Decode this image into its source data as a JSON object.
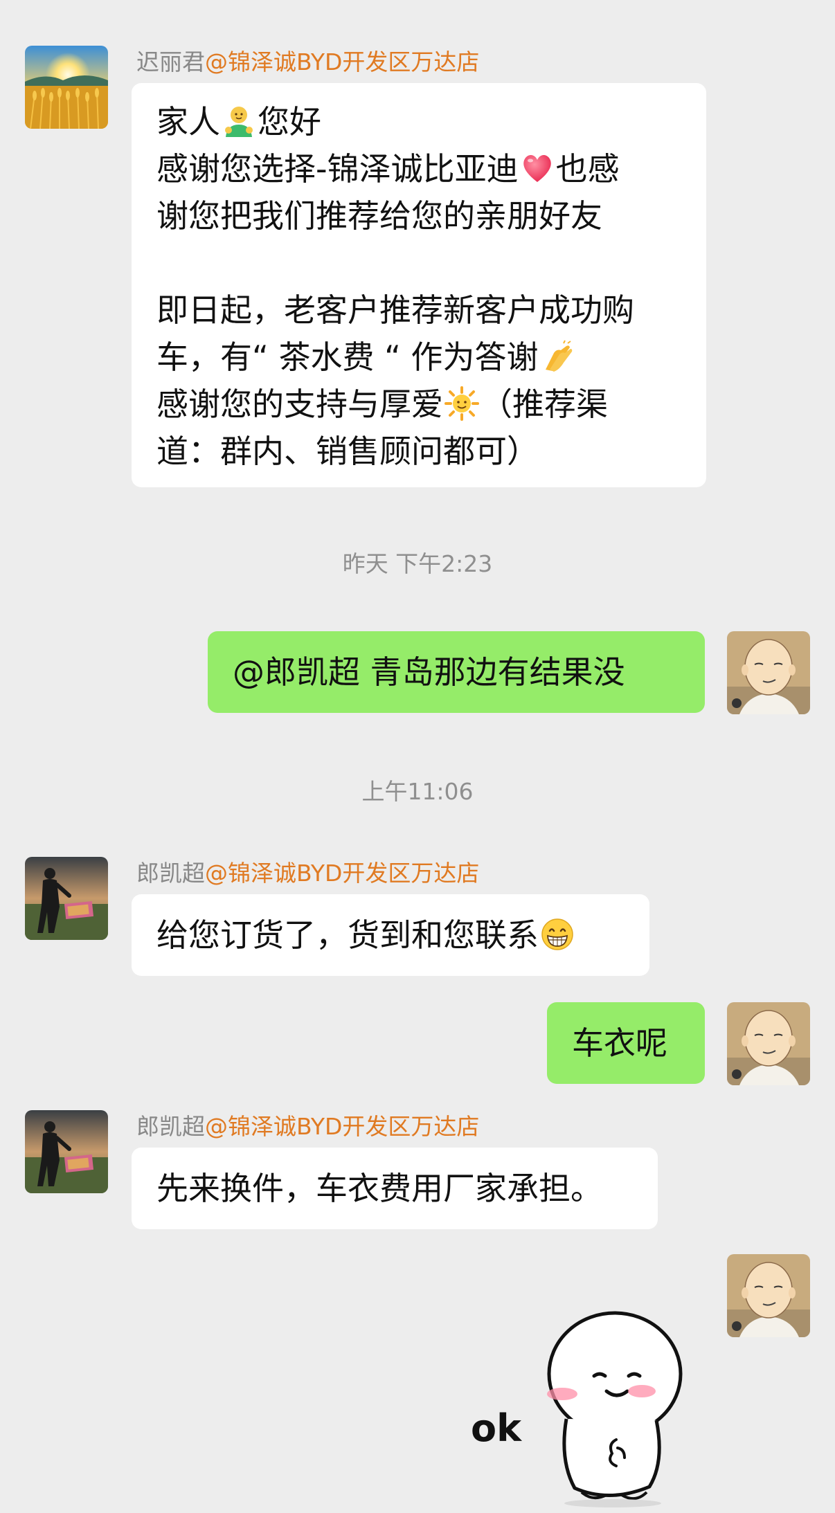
{
  "colors": {
    "background": "#ededed",
    "bubble_white": "#ffffff",
    "bubble_green": "#95ec69",
    "sender_name": "#888888",
    "group_name": "#e07a22",
    "timestamp": "#8f8f8f"
  },
  "messages": {
    "m1": {
      "sender_name": "迟丽君",
      "group": "@锦泽诚BYD开发区万达店",
      "avatar_icon": "wheat-field-sunset-icon",
      "line1a": "家人",
      "emoji1": "hugging-person-emoji",
      "line1b": "您好",
      "line2a": "感谢您选择-锦泽诚比亚迪",
      "emoji2": "heart-emoji",
      "line2b": "也感",
      "line3": "谢您把我们推荐给您的亲朋好友",
      "line4": "即日起，老客户推荐新客户成功购",
      "line5a": "车，有“ 茶水费 “ 作为答谢",
      "emoji3": "clapping-hands-emoji",
      "line6a": "感谢您的支持与厚爱",
      "emoji4": "sun-emoji",
      "line6b": "（推荐渠",
      "line7": "道：群内、销售顾问都可）"
    },
    "ts1": "昨天 下午2:23",
    "m2": {
      "text": "@郎凯超  青岛那边有结果没",
      "avatar_icon": "bald-hero-avatar-icon"
    },
    "ts2": "上午11:06",
    "m3": {
      "sender_name": "郎凯超",
      "group": "@锦泽诚BYD开发区万达店",
      "avatar_icon": "man-in-field-avatar-icon",
      "text": "给您订货了，货到和您联系",
      "emoji": "grinning-face-emoji"
    },
    "m4": {
      "text": "车衣呢",
      "avatar_icon": "bald-hero-avatar-icon"
    },
    "m5": {
      "sender_name": "郎凯超",
      "group": "@锦泽诚BYD开发区万达店",
      "avatar_icon": "man-in-field-avatar-icon",
      "text": "先来换件，车衣费用厂家承担。"
    },
    "m6": {
      "avatar_icon": "bald-hero-avatar-icon",
      "sticker_icon": "ok-sticker-icon",
      "sticker_text": "ok"
    }
  }
}
